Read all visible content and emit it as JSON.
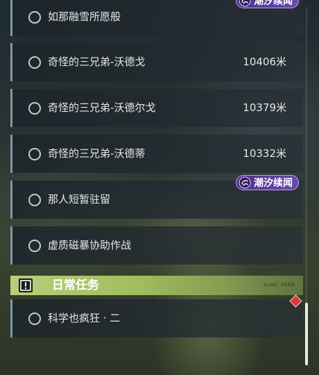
{
  "quests": [
    {
      "title": "如那融雪所愿般",
      "distance": ""
    },
    {
      "title": "奇怪的三兄弟-沃德戈",
      "distance": "10406米"
    },
    {
      "title": "奇怪的三兄弟-沃德尔戈",
      "distance": "10379米"
    },
    {
      "title": "奇怪的三兄弟-沃德蒂",
      "distance": "10332米"
    },
    {
      "title": "那人短暂驻留",
      "distance": ""
    },
    {
      "title": "虚质磁暴协助作战",
      "distance": ""
    }
  ],
  "badges": {
    "top_label": "潮汐续闻",
    "mid_label": "潮汐续闻"
  },
  "daily_section": {
    "title": "日常任务",
    "small_text": "每日刷新 · 剩余数量"
  },
  "daily_quests": [
    {
      "title": "科学也疯狂 · 二"
    }
  ],
  "colors": {
    "badge_purple": "#6a4ab0",
    "section_green": "#b7cf7a",
    "row_accent": "#7f9aa3",
    "marker_red": "#d93a3a"
  },
  "icons": {
    "quest_status": "circle-outline-icon",
    "badge": "tide-swirl-icon",
    "section": "exclamation-box-icon",
    "tracking": "red-diamond-icon"
  }
}
